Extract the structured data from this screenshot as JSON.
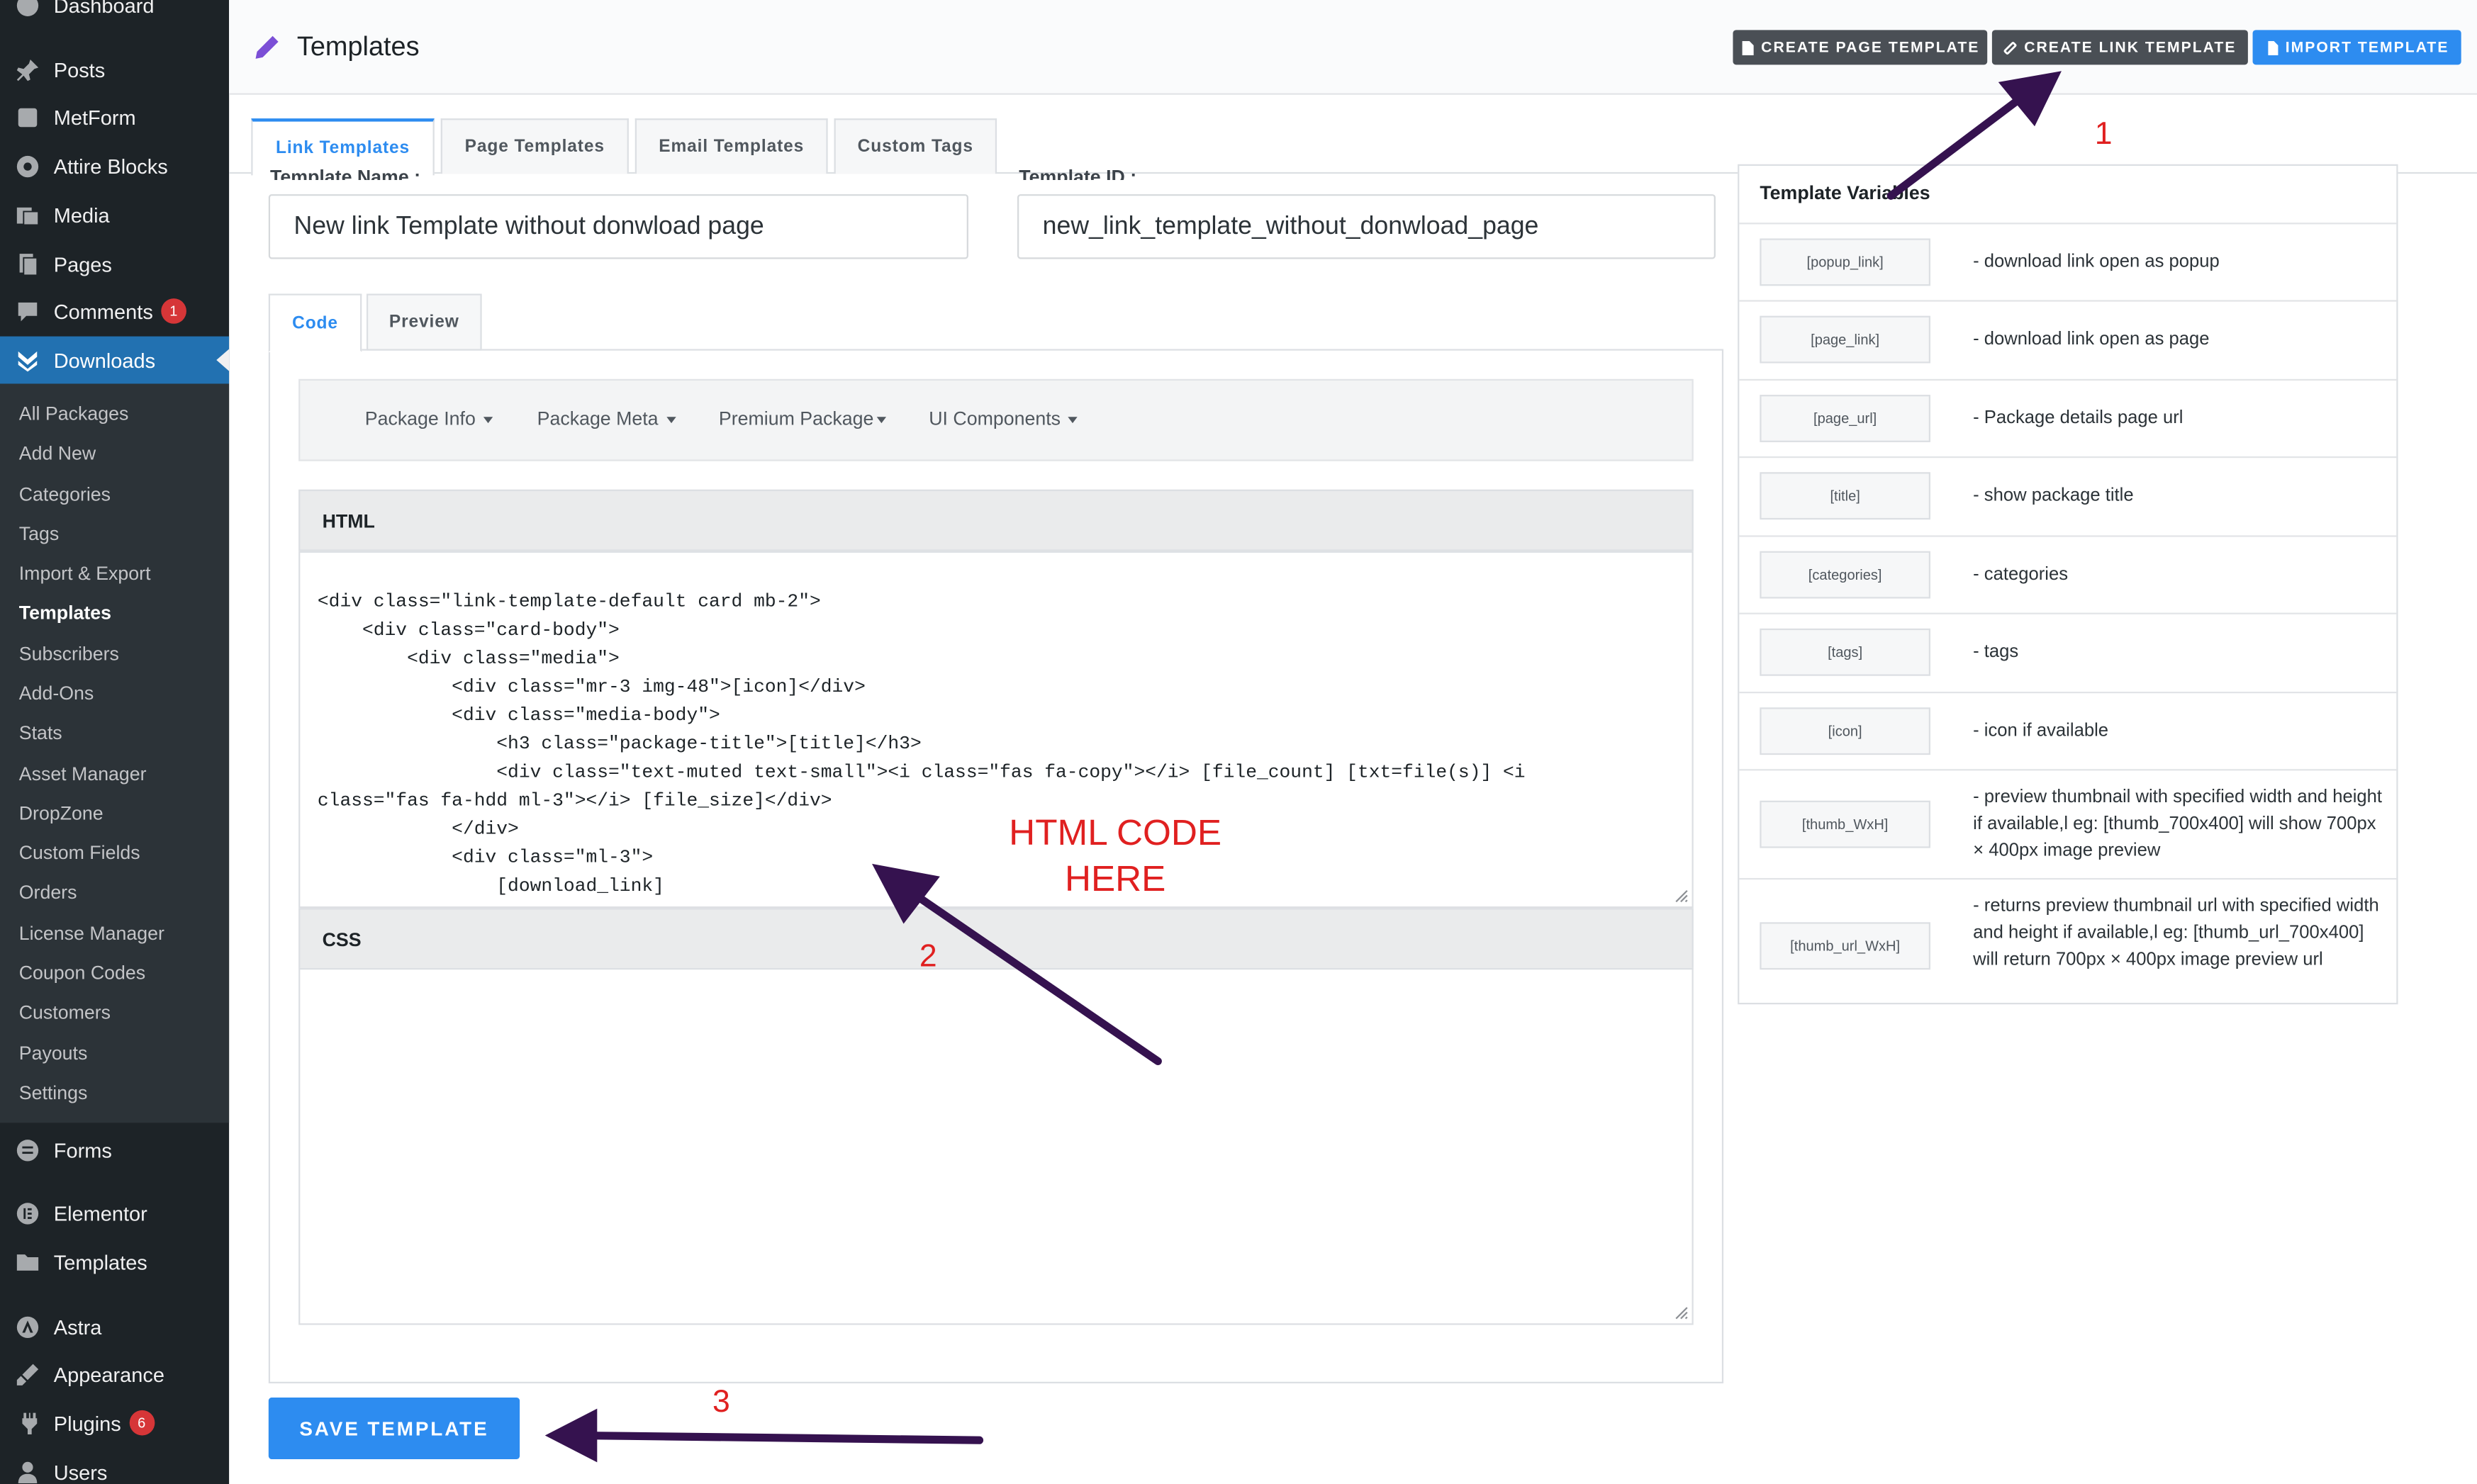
{
  "sidebar": {
    "top_item": "Dashboard",
    "items": [
      {
        "label": "Posts",
        "icon": "pin-icon"
      },
      {
        "label": "MetForm",
        "icon": "form-icon"
      },
      {
        "label": "Attire Blocks",
        "icon": "blocks-icon"
      },
      {
        "label": "Media",
        "icon": "media-icon"
      },
      {
        "label": "Pages",
        "icon": "pages-icon"
      },
      {
        "label": "Comments",
        "icon": "comment-icon",
        "badge": "1"
      },
      {
        "label": "Downloads",
        "icon": "download-icon"
      }
    ],
    "submenu": [
      "All Packages",
      "Add New",
      "Categories",
      "Tags",
      "Import & Export",
      "Templates",
      "Subscribers",
      "Add-Ons",
      "Stats",
      "Asset Manager",
      "DropZone",
      "Custom Fields",
      "Orders",
      "License Manager",
      "Coupon Codes",
      "Customers",
      "Payouts",
      "Settings"
    ],
    "bottom_items": [
      {
        "label": "Forms",
        "icon": "forms-icon"
      },
      {
        "label": "Elementor",
        "icon": "elementor-icon"
      },
      {
        "label": "Templates",
        "icon": "folder-icon"
      },
      {
        "label": "Astra",
        "icon": "astra-icon"
      },
      {
        "label": "Appearance",
        "icon": "brush-icon"
      },
      {
        "label": "Plugins",
        "icon": "plug-icon",
        "badge": "6"
      },
      {
        "label": "Users",
        "icon": "user-icon"
      }
    ]
  },
  "header": {
    "title": "Templates",
    "buttons": [
      "CREATE PAGE TEMPLATE",
      "CREATE LINK TEMPLATE",
      "IMPORT TEMPLATE"
    ]
  },
  "tabs": [
    "Link Templates",
    "Page Templates",
    "Email Templates",
    "Custom Tags"
  ],
  "form": {
    "name_label": "Template Name :",
    "name_value": "New link Template without donwload page",
    "id_label": "Template ID :",
    "id_value": "new_link_template_without_donwload_page"
  },
  "inner_tabs": [
    "Code",
    "Preview"
  ],
  "toolbar": [
    "Package Info",
    "Package Meta",
    "Premium Package",
    "UI Components"
  ],
  "html_section": {
    "label": "HTML",
    "code": "<div class=\"link-template-default card mb-2\">\n    <div class=\"card-body\">\n        <div class=\"media\">\n            <div class=\"mr-3 img-48\">[icon]</div>\n            <div class=\"media-body\">\n                <h3 class=\"package-title\">[title]</h3>\n                <div class=\"text-muted text-small\"><i class=\"fas fa-copy\"></i> [file_count] [txt=file(s)] <i\nclass=\"fas fa-hdd ml-3\"></i> [file_size]</div>\n            </div>\n            <div class=\"ml-3\">\n                [download_link]"
  },
  "css_section": {
    "label": "CSS"
  },
  "save_button": "SAVE TEMPLATE",
  "variables": {
    "title": "Template Variables",
    "rows": [
      {
        "tag": "[popup_link]",
        "desc": "- download link open as popup"
      },
      {
        "tag": "[page_link]",
        "desc": "- download link open as page"
      },
      {
        "tag": "[page_url]",
        "desc": "- Package details page url"
      },
      {
        "tag": "[title]",
        "desc": "- show package title"
      },
      {
        "tag": "[categories]",
        "desc": "- categories"
      },
      {
        "tag": "[tags]",
        "desc": "- tags"
      },
      {
        "tag": "[icon]",
        "desc": "- icon if available"
      },
      {
        "tag": "[thumb_WxH]",
        "desc": "- preview thumbnail with specified width and height if available,l eg: [thumb_700x400] will show 700px × 400px image preview"
      },
      {
        "tag": "[thumb_url_WxH]",
        "desc": "- returns preview thumbnail url with specified width and height if available,l eg: [thumb_url_700x400] will return 700px × 400px image preview url"
      }
    ]
  },
  "annotations": {
    "n1": "1",
    "n2": "2",
    "n3": "3",
    "html_code_line1": "HTML CODE",
    "html_code_line2": "HERE"
  },
  "colors": {
    "accent": "#2d8cf0",
    "sidebar": "#1d2327",
    "annotation": "#e02020",
    "arrow": "#35124f"
  }
}
